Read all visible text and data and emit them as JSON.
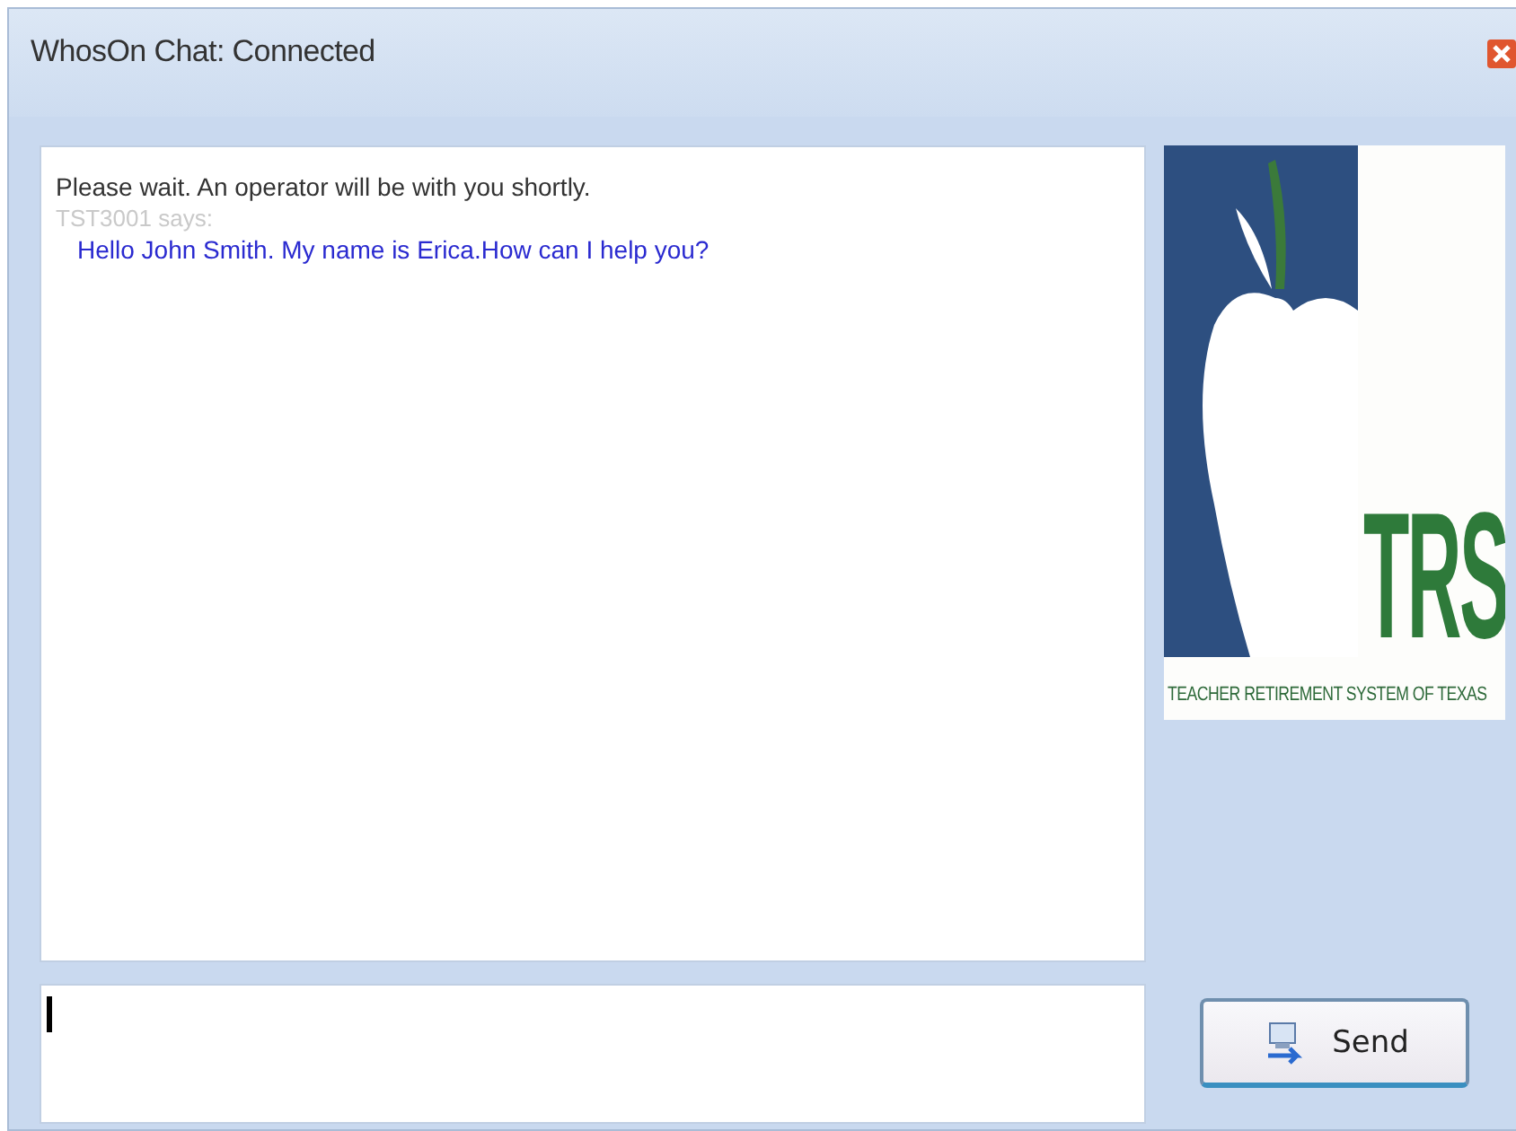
{
  "window": {
    "title": "WhosOn Chat: Connected"
  },
  "transcript": [
    {
      "kind": "system",
      "text": "Please wait. An operator will be with you shortly."
    },
    {
      "kind": "sender",
      "text": "TST3001 says:"
    },
    {
      "kind": "message",
      "text": "Hello John Smith. My name is Erica.How can I help you?"
    }
  ],
  "logo": {
    "initials": "TRS",
    "caption": "TEACHER RETIREMENT SYSTEM OF TEXAS"
  },
  "send_button": {
    "label": "Send"
  }
}
